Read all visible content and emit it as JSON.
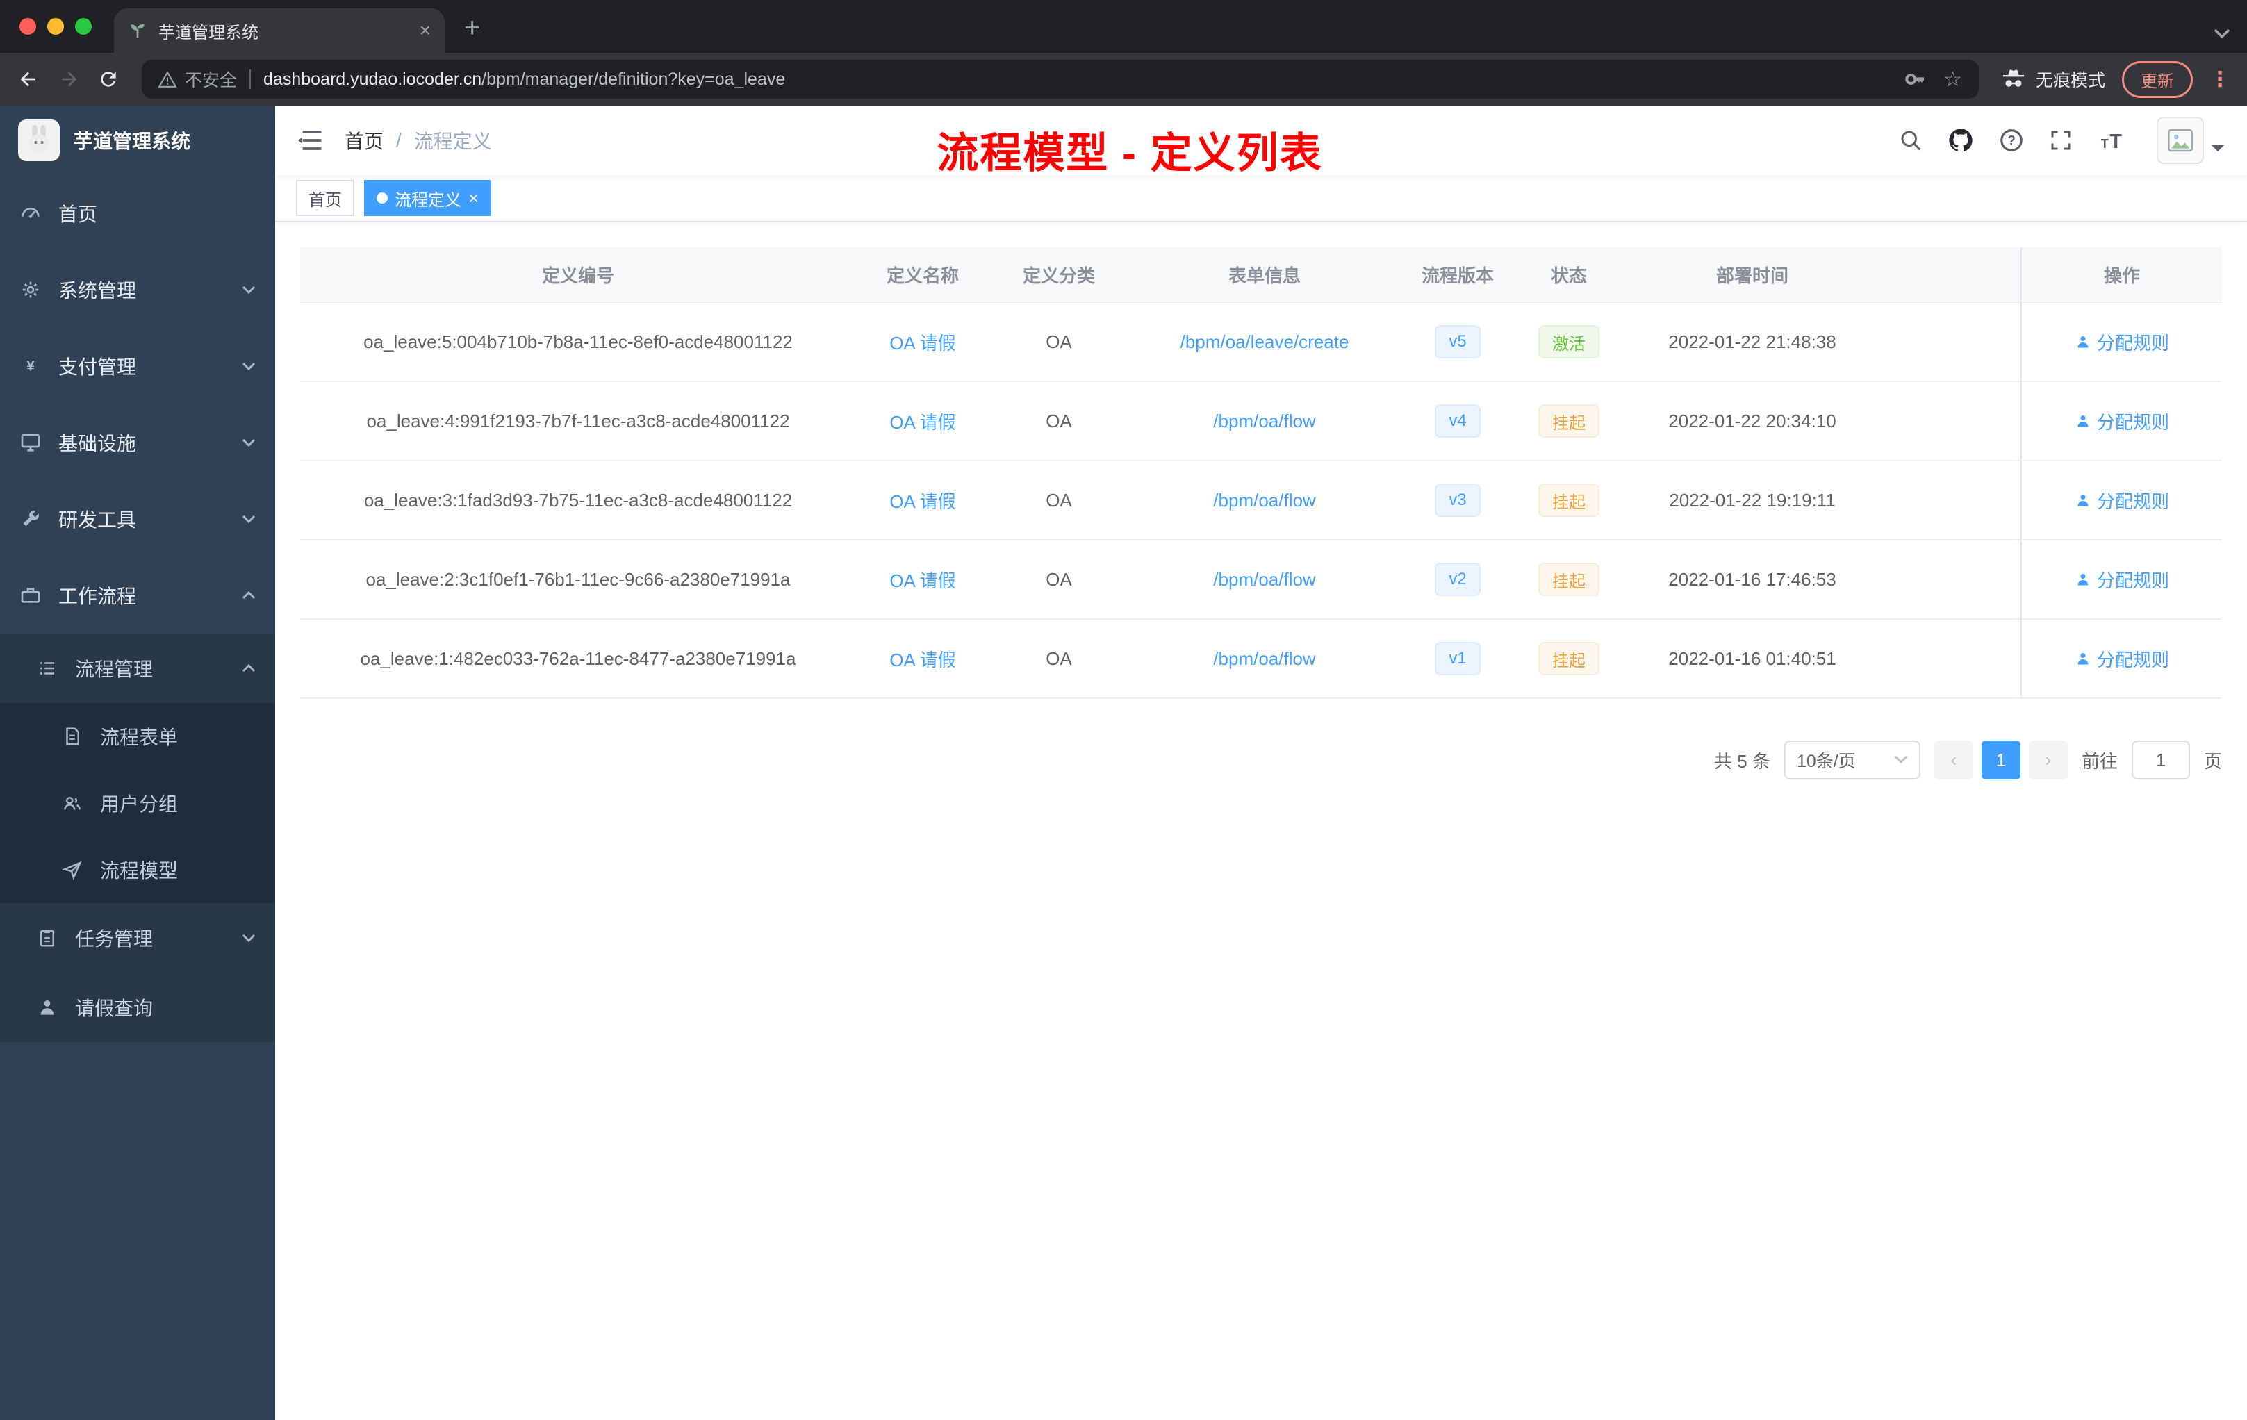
{
  "browser": {
    "tab_title": "芋道管理系统",
    "security_label": "不安全",
    "url_host": "dashboard.yudao.iocoder.cn",
    "url_path": "/bpm/manager/definition?key=oa_leave",
    "incognito_label": "无痕模式",
    "update_label": "更新"
  },
  "icons": {
    "close": "×",
    "new_tab": "+",
    "kebab": "⋮",
    "star": "☆",
    "prev": "‹",
    "next": "›"
  },
  "sidebar": {
    "app_title": "芋道管理系统",
    "items": [
      {
        "label": "首页"
      },
      {
        "label": "系统管理"
      },
      {
        "label": "支付管理"
      },
      {
        "label": "基础设施"
      },
      {
        "label": "研发工具"
      },
      {
        "label": "工作流程"
      },
      {
        "label": "流程管理"
      },
      {
        "label": "流程表单"
      },
      {
        "label": "用户分组"
      },
      {
        "label": "流程模型"
      },
      {
        "label": "任务管理"
      },
      {
        "label": "请假查询"
      }
    ]
  },
  "navbar": {
    "breadcrumb": {
      "home": "首页",
      "separator": "/",
      "current": "流程定义"
    }
  },
  "annotation": "流程模型 - 定义列表",
  "tags_view": {
    "home": "首页",
    "current": "流程定义"
  },
  "table": {
    "headers": {
      "id": "定义编号",
      "name": "定义名称",
      "category": "定义分类",
      "form": "表单信息",
      "version": "流程版本",
      "status": "状态",
      "deploy_time": "部署时间",
      "actions": "操作"
    },
    "rows": [
      {
        "id": "oa_leave:5:004b710b-7b8a-11ec-8ef0-acde48001122",
        "name": "OA 请假",
        "category": "OA",
        "form": "/bpm/oa/leave/create",
        "version": "v5",
        "status": "激活",
        "deploy_time": "2022-01-22 21:48:38",
        "action": "分配规则"
      },
      {
        "id": "oa_leave:4:991f2193-7b7f-11ec-a3c8-acde48001122",
        "name": "OA 请假",
        "category": "OA",
        "form": "/bpm/oa/flow",
        "version": "v4",
        "status": "挂起",
        "deploy_time": "2022-01-22 20:34:10",
        "action": "分配规则"
      },
      {
        "id": "oa_leave:3:1fad3d93-7b75-11ec-a3c8-acde48001122",
        "name": "OA 请假",
        "category": "OA",
        "form": "/bpm/oa/flow",
        "version": "v3",
        "status": "挂起",
        "deploy_time": "2022-01-22 19:19:11",
        "action": "分配规则"
      },
      {
        "id": "oa_leave:2:3c1f0ef1-76b1-11ec-9c66-a2380e71991a",
        "name": "OA 请假",
        "category": "OA",
        "form": "/bpm/oa/flow",
        "version": "v2",
        "status": "挂起",
        "deploy_time": "2022-01-16 17:46:53",
        "action": "分配规则"
      },
      {
        "id": "oa_leave:1:482ec033-762a-11ec-8477-a2380e71991a",
        "name": "OA 请假",
        "category": "OA",
        "form": "/bpm/oa/flow",
        "version": "v1",
        "status": "挂起",
        "deploy_time": "2022-01-16 01:40:51",
        "action": "分配规则"
      }
    ]
  },
  "pagination": {
    "total": "共 5 条",
    "page_size": "10条/页",
    "page": "1",
    "goto_label": "前往",
    "goto_value": "1",
    "unit_label": "页"
  }
}
